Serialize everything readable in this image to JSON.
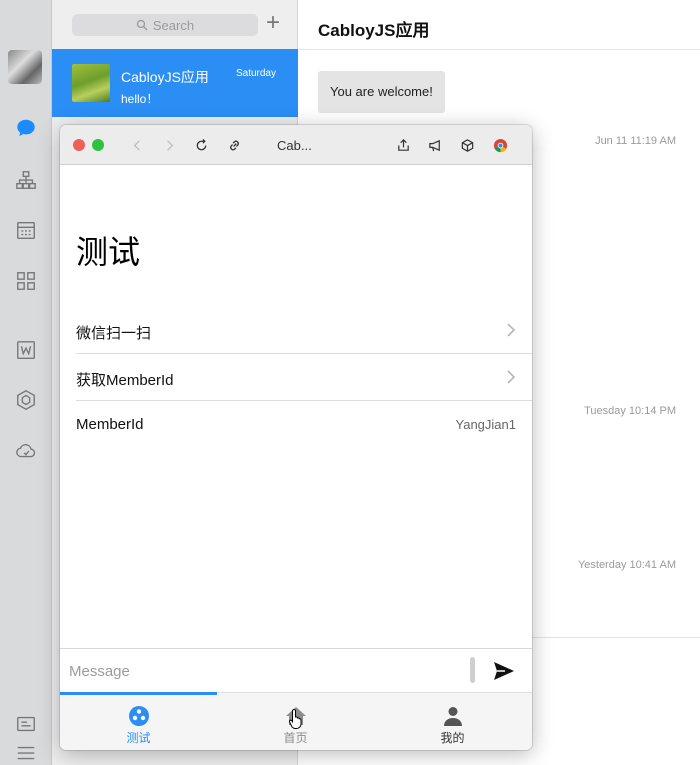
{
  "sidebar": {
    "icons": [
      "avatar",
      "chat-bubble-icon",
      "org-chart-icon",
      "calendar-grid-icon",
      "apps-grid-icon",
      "word-doc-icon",
      "hexagon-icon",
      "cloud-icon",
      "contacts-card-icon",
      "hamburger-menu-icon"
    ],
    "active_color": "#1a8cff"
  },
  "list": {
    "search_placeholder": "Search",
    "add_label": "+",
    "conversation": {
      "name": "CabloyJS应用",
      "last_message": "hello！",
      "time": "Saturday"
    }
  },
  "chat": {
    "title": "CabloyJS应用",
    "bubble": "You are welcome!",
    "timestamps": [
      "Jun 11 11:19 AM",
      "Tuesday 10:14 PM",
      "Yesterday 10:41 AM"
    ]
  },
  "browser": {
    "title": "Cab...",
    "heading": "测试",
    "rows": [
      {
        "label": "微信扫一扫",
        "type": "link"
      },
      {
        "label": "获取MemberId",
        "type": "link"
      },
      {
        "label": "MemberId",
        "type": "value",
        "value": "YangJian1"
      }
    ],
    "message_placeholder": "Message",
    "tabs": [
      {
        "label": "测试",
        "icon": "palette-icon",
        "active": true
      },
      {
        "label": "首页",
        "icon": "home-icon",
        "active": false
      },
      {
        "label": "我的",
        "icon": "person-icon",
        "active": false
      }
    ],
    "colors": {
      "accent": "#2b8ef5",
      "close": "#ed5f57",
      "maximize": "#2fc23f"
    }
  }
}
